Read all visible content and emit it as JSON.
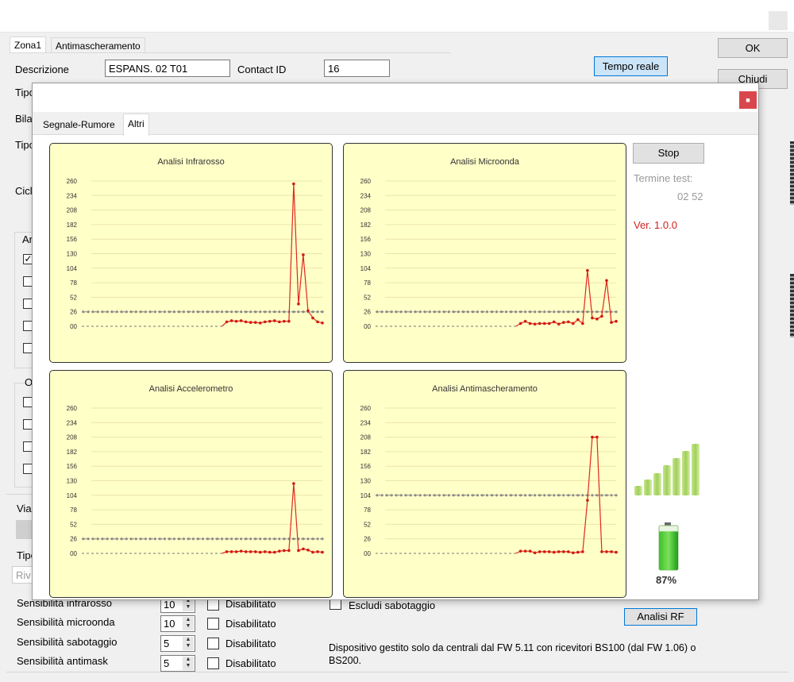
{
  "main_window": {
    "tabs": [
      {
        "label": "Zona1",
        "active": true
      },
      {
        "label": "Antimascheramento",
        "active": false
      }
    ],
    "descrizione_label": "Descrizione",
    "descrizione_value": "ESPANS. 02 T01",
    "contact_id_label": "Contact ID",
    "contact_id_value": "16",
    "tempo_reale_label": "Tempo reale",
    "ok_label": "OK",
    "chiudi_label": "Chiudi",
    "partial_labels": {
      "tipo1": "Tipo",
      "bila": "Bila",
      "tipo2": "Tipo",
      "cicl": "Cicl",
      "ar": "Ar",
      "o": "O",
      "via": "Via",
      "tipo3": "Tipo",
      "riv": "Riv"
    },
    "left_checkboxes_group1": [
      true,
      false,
      false,
      false,
      false
    ],
    "left_checkboxes_group2": [
      false,
      false,
      false,
      false
    ],
    "sensitivities": [
      {
        "label": "Sensibilità infrarosso",
        "value": "10",
        "disabled_label": "Disabilitato",
        "disabled": false
      },
      {
        "label": "Sensibilità microonda",
        "value": "10",
        "disabled_label": "Disabilitato",
        "disabled": false
      },
      {
        "label": "Sensibilità sabotaggio",
        "value": "5",
        "disabled_label": "Disabilitato",
        "disabled": false
      },
      {
        "label": "Sensibilità antimask",
        "value": "5",
        "disabled_label": "Disabilitato",
        "disabled": false
      }
    ],
    "escludi_sabotaggio_label": "Escludi sabotaggio",
    "escludi_sabotaggio_checked": false,
    "analisi_rf_label": "Analisi RF",
    "note": "Dispositivo gestito solo da centrali dal FW 5.11 con ricevitori BS100 (dal FW 1.06) o BS200."
  },
  "modal": {
    "close_icon": "close-icon",
    "tabs": [
      {
        "label": "Segnale-Rumore",
        "active": false
      },
      {
        "label": "Altri",
        "active": true
      }
    ],
    "stop_label": "Stop",
    "termine_test_label": "Termine test:",
    "termine_test_value": "02 52",
    "version": "Ver. 1.0.0",
    "signal_icon": "signal-strength-icon",
    "battery_icon": "battery-icon",
    "battery_percent": "87%",
    "battery_level": 0.87,
    "colors": {
      "chart_bg": "#ffffc8",
      "series": "#e0281e",
      "threshold": "#7f7f7f",
      "version_text": "#d42020",
      "close_button": "#d9474e"
    }
  },
  "chart_data": [
    {
      "type": "line",
      "title": "Analisi Infrarosso",
      "yticks": [
        "260",
        "234",
        "208",
        "182",
        "156",
        "130",
        "104",
        "78",
        "52",
        "26",
        "00"
      ],
      "ylim": [
        0,
        260
      ],
      "grid": true,
      "threshold": 26,
      "n_points": 50,
      "values": [
        0,
        0,
        0,
        0,
        0,
        0,
        0,
        0,
        0,
        0,
        0,
        0,
        0,
        0,
        0,
        0,
        0,
        0,
        0,
        0,
        0,
        0,
        0,
        0,
        0,
        0,
        0,
        0,
        0,
        0,
        8,
        10,
        9,
        10,
        8,
        7,
        7,
        6,
        8,
        9,
        10,
        8,
        9,
        9,
        255,
        40,
        128,
        28,
        15,
        8,
        6
      ]
    },
    {
      "type": "line",
      "title": "Analisi Microonda",
      "yticks": [
        "260",
        "234",
        "208",
        "182",
        "156",
        "130",
        "104",
        "78",
        "52",
        "26",
        "00"
      ],
      "ylim": [
        0,
        260
      ],
      "grid": true,
      "threshold": 26,
      "n_points": 50,
      "values": [
        0,
        0,
        0,
        0,
        0,
        0,
        0,
        0,
        0,
        0,
        0,
        0,
        0,
        0,
        0,
        0,
        0,
        0,
        0,
        0,
        0,
        0,
        0,
        0,
        0,
        0,
        0,
        0,
        0,
        0,
        5,
        9,
        5,
        4,
        5,
        5,
        5,
        8,
        4,
        7,
        8,
        5,
        12,
        5,
        100,
        15,
        13,
        18,
        82,
        7,
        9
      ]
    },
    {
      "type": "line",
      "title": "Analisi Accelerometro",
      "yticks": [
        "260",
        "234",
        "208",
        "182",
        "156",
        "130",
        "104",
        "78",
        "52",
        "26",
        "00"
      ],
      "ylim": [
        0,
        260
      ],
      "grid": true,
      "threshold": 26,
      "n_points": 50,
      "values": [
        0,
        0,
        0,
        0,
        0,
        0,
        0,
        0,
        0,
        0,
        0,
        0,
        0,
        0,
        0,
        0,
        0,
        0,
        0,
        0,
        0,
        0,
        0,
        0,
        0,
        0,
        0,
        0,
        0,
        0,
        3,
        3,
        3,
        4,
        3,
        3,
        3,
        2,
        3,
        2,
        2,
        4,
        5,
        5,
        125,
        5,
        8,
        6,
        2,
        3,
        2
      ]
    },
    {
      "type": "line",
      "title": "Analisi Antimascheramento",
      "yticks": [
        "260",
        "234",
        "208",
        "182",
        "156",
        "130",
        "104",
        "78",
        "52",
        "26",
        "00"
      ],
      "ylim": [
        0,
        260
      ],
      "grid": true,
      "threshold": 104,
      "n_points": 50,
      "values": [
        0,
        0,
        0,
        0,
        0,
        0,
        0,
        0,
        0,
        0,
        0,
        0,
        0,
        0,
        0,
        0,
        0,
        0,
        0,
        0,
        0,
        0,
        0,
        0,
        0,
        0,
        0,
        0,
        0,
        0,
        4,
        4,
        4,
        1,
        3,
        3,
        3,
        2,
        3,
        3,
        3,
        1,
        2,
        3,
        95,
        208,
        208,
        3,
        3,
        3,
        2
      ]
    }
  ]
}
